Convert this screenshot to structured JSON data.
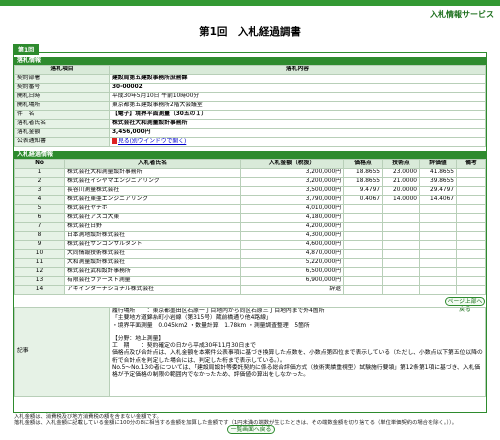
{
  "service": "入札情報サービス",
  "title": "第1回　入札経過調書",
  "tab": "第1回",
  "winner_section": {
    "header": "落札情報",
    "col_item": "落札項目",
    "col_content": "落札内容",
    "rows": [
      {
        "label": "契約部署",
        "value": "建設局第五建設事務所庶務課",
        "bold": true
      },
      {
        "label": "契約番号",
        "value": "30-00002",
        "bold": true
      },
      {
        "label": "開札日時",
        "value": "平成30年5月10日 午前10時00分",
        "bold": false
      },
      {
        "label": "開札場所",
        "value": "東京都第五建設事務所2階大会議室",
        "bold": false
      },
      {
        "label": "件　名",
        "value": "【電子】境界平面測量（30五の１）",
        "bold": true
      },
      {
        "label": "落札者氏名",
        "value": "株式会社大和測量設計事務所",
        "bold": true
      },
      {
        "label": "落札金額",
        "value": "3,456,000円",
        "bold": true
      },
      {
        "label": "公表通知書",
        "value": "見る(別ウインドウで開く)",
        "bold": false
      }
    ]
  },
  "bid_section": {
    "header": "入札経過情報",
    "headers": [
      "No",
      "入札者氏名",
      "入札金額（税抜）",
      "価格点",
      "技術点",
      "評価値",
      "備考"
    ],
    "rows": [
      [
        "1",
        "株式会社大和測量設計事務所",
        "3,200,000円",
        "18.8655",
        "23.0000",
        "41.8655",
        ""
      ],
      [
        "2",
        "株式会社イシヤマエンジニアリング",
        "3,200,000円",
        "18.8655",
        "21.0000",
        "39.8655",
        ""
      ],
      [
        "3",
        "長谷川測量株式会社",
        "3,500,000円",
        "9.4797",
        "20.0000",
        "29.4797",
        ""
      ],
      [
        "4",
        "株式会社東亜エンジニアリング",
        "3,790,000円",
        "0.4067",
        "14.0000",
        "14.4067",
        ""
      ],
      [
        "5",
        "株式会社ヤチホ",
        "4,010,000円",
        "",
        "",
        "",
        ""
      ],
      [
        "6",
        "株式会社アスコ大東",
        "4,180,000円",
        "",
        "",
        "",
        ""
      ],
      [
        "7",
        "株式会社日野",
        "4,200,000円",
        "",
        "",
        "",
        ""
      ],
      [
        "8",
        "日本測地設計株式会社",
        "4,300,000円",
        "",
        "",
        "",
        ""
      ],
      [
        "9",
        "株式会社サンコンサルタント",
        "4,600,000円",
        "",
        "",
        "",
        ""
      ],
      [
        "10",
        "大同情報技術株式会社",
        "4,870,000円",
        "",
        "",
        "",
        ""
      ],
      [
        "11",
        "大和測量設計株式会社",
        "5,220,000円",
        "",
        "",
        "",
        ""
      ],
      [
        "12",
        "株式会社武和設計事務所",
        "6,500,000円",
        "",
        "",
        "",
        ""
      ],
      [
        "13",
        "有限会社ファースト測量",
        "6,900,000円",
        "",
        "",
        "",
        ""
      ],
      [
        "14",
        "アキインターナショナル株式会社",
        "辞退",
        "",
        "",
        "",
        ""
      ]
    ]
  },
  "page_top_button": "ページ上部へ戻る",
  "remarks": {
    "label": "記事",
    "lines": [
      "履行場所　　：東京都墨田区石原一丁目地内から同区石原三丁目地内まで外4箇所",
      "「主要地方道錦糸町小岩線（第315号）蔵前橋通り他4路線」",
      "・境界平面測量　0.045km2 ・数量計算　1.78km ・測量調査整理　5箇所",
      "",
      "【分野：地上測量】",
      "工　期　　：契約確定の日から平成30年11月30日まで",
      "価格点及び合計点は、入札金額を本案件公表事項に基づき換算した点数を、小数点第四位まで表示している（ただし、小数点以下第五位以降の桁で合計点を判定した場合には、判定した桁まで表示している。）。",
      "No.5〜No.13の者については、「建設局設計等委託契約に係る総合評価方式（技術実績重視型）試験施行要領」第12条第1項に基づき、入札価格が予定価格の制限の範囲内でなかったため、評価値の算出をしなかった。"
    ]
  },
  "footnotes": [
    "入札金額は、消費税及び地方消費税の額を含まない金額です。",
    "落札金額は、入札金額に記載している金額に100分の8に相当する金額を加算した金額です（1円未満の端数が生じたときは、その端数金額を切り捨てる（単位単価契約の場合を除く。））。"
  ],
  "back_button": "一覧画面へ戻る"
}
